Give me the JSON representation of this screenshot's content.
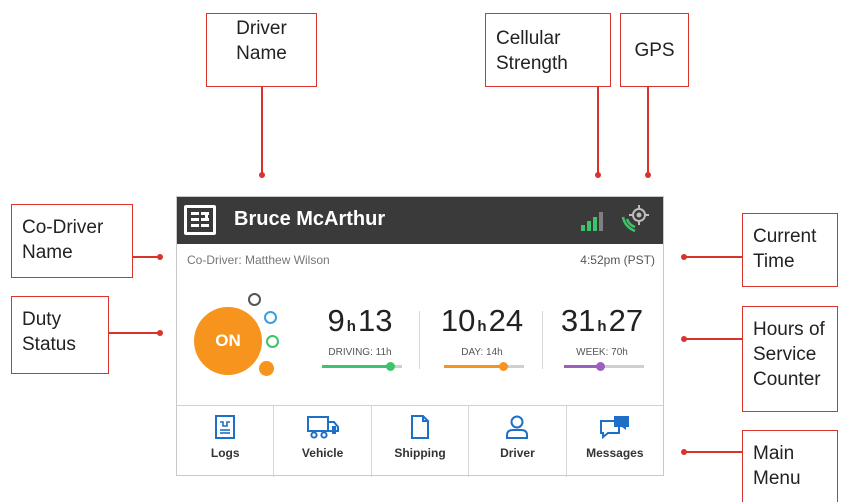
{
  "callouts": {
    "driver_name": "Driver\nName",
    "cellular_strength": "Cellular\nStrength",
    "gps": "GPS",
    "co_driver_name": "Co-Driver\nName",
    "duty_status": "Duty\nStatus",
    "current_time": "Current\nTime",
    "hos_counter": "Hours of\nService\nCounter",
    "main_menu": "Main\nMenu"
  },
  "device": {
    "driver_name": "Bruce McArthur",
    "co_driver": "Co-Driver: Matthew Wilson",
    "current_time": "4:52pm (PST)",
    "duty_status": "ON",
    "signal_icon": "cellular-signal-icon",
    "gps_icon": "gps-icon",
    "counters": [
      {
        "hours": "9",
        "minutes": "13",
        "unit": "h",
        "label": "DRIVING: 11h",
        "progress": 0.85,
        "color": "#3cc46a"
      },
      {
        "hours": "10",
        "minutes": "24",
        "unit": "h",
        "label": "DAY: 14h",
        "progress": 0.74,
        "color": "#f7941d"
      },
      {
        "hours": "31",
        "minutes": "27",
        "unit": "h",
        "label": "WEEK: 70h",
        "progress": 0.45,
        "color": "#9b5fc0"
      }
    ],
    "menu": [
      {
        "label": "Logs",
        "icon": "logs-icon"
      },
      {
        "label": "Vehicle",
        "icon": "truck-icon"
      },
      {
        "label": "Shipping",
        "icon": "document-icon"
      },
      {
        "label": "Driver",
        "icon": "person-icon"
      },
      {
        "label": "Messages",
        "icon": "chat-icon"
      }
    ]
  },
  "colors": {
    "accent_blue": "#1e6fc8",
    "callout_red": "#d9342b",
    "topbar": "#3a3a3a",
    "duty_orange": "#f7941d"
  }
}
